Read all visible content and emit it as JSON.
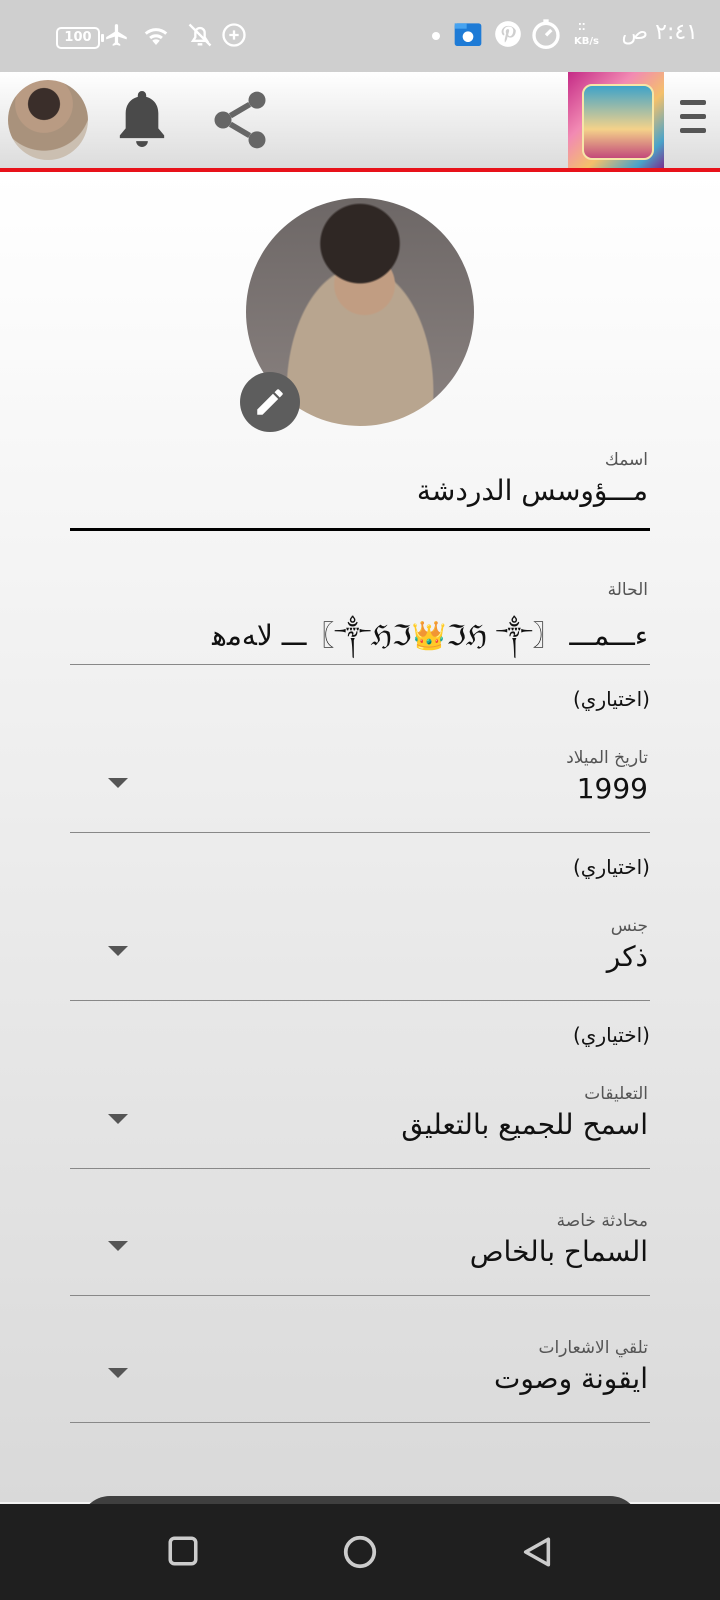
{
  "status_bar": {
    "time": "٢:٤١ ص",
    "battery": "100",
    "network_speed_unit": "KB/s"
  },
  "app_bar": {
    "icons": [
      "avatar",
      "bell-icon",
      "share-icon",
      "banner-image",
      "menu-icon"
    ]
  },
  "profile": {
    "name_label": "اسمك",
    "name_value": "مـــؤوسس الدردشة",
    "status_label": "الحالة",
    "status_value": "ءـــمـــ 〖༒ℌℑ👑ℑℌ ༒〗ـــ ﻻﻪﻣﻫ",
    "status_hint": "(اختياري)",
    "birth_label": "تاريخ الميلاد",
    "birth_value": "1999",
    "birth_hint": "(اختياري)",
    "gender_label": "جنس",
    "gender_value": "ذكر",
    "gender_hint": "(اختياري)",
    "comments_label": "التعليقات",
    "comments_value": "اسمح للجميع بالتعليق",
    "private_label": "محادثة خاصة",
    "private_value": "السماح بالخاص",
    "notify_label": "تلقي الاشعارات",
    "notify_value": "ايقونة وصوت"
  },
  "colors": {
    "accent_line": "#e8121a",
    "icon_gray": "#5d5d5d"
  }
}
